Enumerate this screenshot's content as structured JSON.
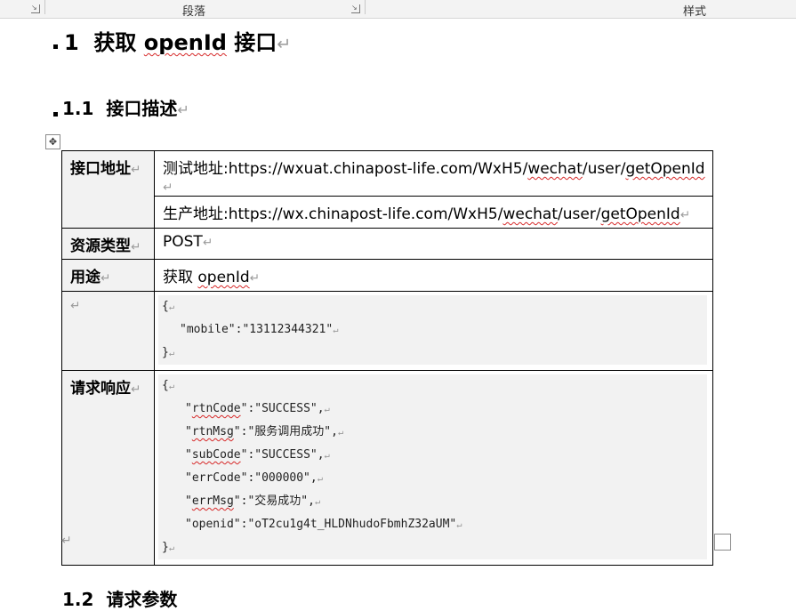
{
  "ribbon": {
    "group_paragraph": "段落",
    "group_styles": "样式"
  },
  "marks": {
    "para": "↵"
  },
  "heading1": {
    "number": "1",
    "title_prefix": "获取 ",
    "title_term": "openId",
    "title_suffix": " 接口"
  },
  "heading2": {
    "number": "1.1",
    "title": "接口描述"
  },
  "table": {
    "address_label": "接口地址",
    "test_prefix": "测试地址:https://wxuat.chinapost-life.com/WxH5/",
    "test_seg1": "wechat",
    "test_mid": "/user/",
    "test_seg2": "getOpenId",
    "prod_prefix": "生产地址:https://wx.chinapost-life.com/WxH5/",
    "prod_seg1": "wechat",
    "prod_mid": "/user/",
    "prod_seg2": "getOpenId",
    "type_label": "资源类型",
    "type_value": "POST",
    "use_label": "用途",
    "use_prefix": "获取 ",
    "use_term": "openId",
    "request_code": [
      "{",
      "\"mobile\":\"13112344321\"",
      "}"
    ],
    "response_label": "请求响应",
    "response": {
      "open": "{",
      "l1_key": "rtnCode",
      "l1_rest": "\":\"SUCCESS\",",
      "l2_key": "rtnMsg",
      "l2_rest": "\":\"服务调用成功\",",
      "l3_key": "subCode",
      "l3_rest": "\":\"SUCCESS\",",
      "l4": "\"errCode\":\"000000\",",
      "l5_key": "errMsg",
      "l5_rest": "\":\"交易成功\",",
      "l6": "\"openid\":\"oT2cu1g4t_HLDNhudoFbmhZ32aUM\"",
      "close": "}"
    }
  },
  "next_heading": {
    "number": "1.2",
    "title": "请求参数"
  }
}
